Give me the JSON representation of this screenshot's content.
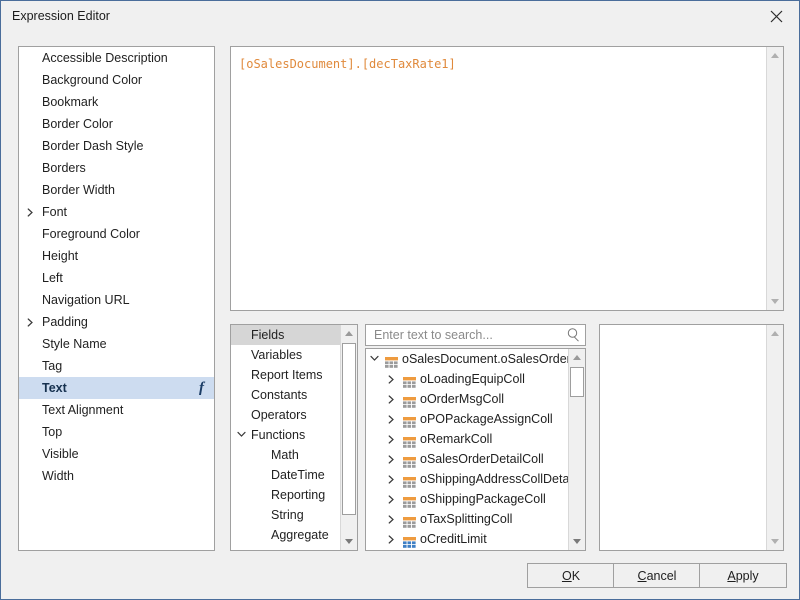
{
  "window": {
    "title": "Expression Editor",
    "close_icon": "close-icon",
    "border_color": "#4a6d9b",
    "background": "#f0f0f0"
  },
  "expression": {
    "value": "[oSalesDocument].[decTaxRate1]",
    "color": "#e08a3c"
  },
  "properties": {
    "selected": "Text",
    "selected_highlight": "#cddcf0",
    "items": [
      {
        "label": "Accessible Description",
        "expandable": false,
        "fx": false
      },
      {
        "label": "Background Color",
        "expandable": false,
        "fx": false
      },
      {
        "label": "Bookmark",
        "expandable": false,
        "fx": false
      },
      {
        "label": "Border Color",
        "expandable": false,
        "fx": false
      },
      {
        "label": "Border Dash Style",
        "expandable": false,
        "fx": false
      },
      {
        "label": "Borders",
        "expandable": false,
        "fx": false
      },
      {
        "label": "Border Width",
        "expandable": false,
        "fx": false
      },
      {
        "label": "Font",
        "expandable": true,
        "fx": false
      },
      {
        "label": "Foreground Color",
        "expandable": false,
        "fx": false
      },
      {
        "label": "Height",
        "expandable": false,
        "fx": false
      },
      {
        "label": "Left",
        "expandable": false,
        "fx": false
      },
      {
        "label": "Navigation URL",
        "expandable": false,
        "fx": false
      },
      {
        "label": "Padding",
        "expandable": true,
        "fx": false
      },
      {
        "label": "Style Name",
        "expandable": false,
        "fx": false
      },
      {
        "label": "Tag",
        "expandable": false,
        "fx": false
      },
      {
        "label": "Text",
        "expandable": false,
        "fx": true,
        "fx_glyph": "f"
      },
      {
        "label": "Text Alignment",
        "expandable": false,
        "fx": false
      },
      {
        "label": "Top",
        "expandable": false,
        "fx": false
      },
      {
        "label": "Visible",
        "expandable": false,
        "fx": false
      },
      {
        "label": "Width",
        "expandable": false,
        "fx": false
      }
    ]
  },
  "categories": {
    "selected": "Fields",
    "selected_highlight": "#d6d6d6",
    "items": [
      {
        "label": "Fields",
        "level": 0,
        "expandable": false
      },
      {
        "label": "Variables",
        "level": 0,
        "expandable": false
      },
      {
        "label": "Report Items",
        "level": 0,
        "expandable": false
      },
      {
        "label": "Constants",
        "level": 0,
        "expandable": false
      },
      {
        "label": "Operators",
        "level": 0,
        "expandable": false
      },
      {
        "label": "Functions",
        "level": 0,
        "expandable": true,
        "expanded": true
      },
      {
        "label": "Math",
        "level": 1,
        "expandable": false
      },
      {
        "label": "DateTime",
        "level": 1,
        "expandable": false
      },
      {
        "label": "Reporting",
        "level": 1,
        "expandable": false
      },
      {
        "label": "String",
        "level": 1,
        "expandable": false
      },
      {
        "label": "Aggregate",
        "level": 1,
        "expandable": false
      }
    ]
  },
  "search": {
    "placeholder": "Enter text to search...",
    "value": "",
    "icon": "search-icon"
  },
  "tree": {
    "nodes": [
      {
        "label": "oSalesDocument.oSalesOrder...",
        "level": 0,
        "expanded": true,
        "icon": "table-icon-orange"
      },
      {
        "label": "oLoadingEquipColl",
        "level": 1,
        "expanded": false,
        "icon": "table-icon-orange"
      },
      {
        "label": "oOrderMsgColl",
        "level": 1,
        "expanded": false,
        "icon": "table-icon-orange"
      },
      {
        "label": "oPOPackageAssignColl",
        "level": 1,
        "expanded": false,
        "icon": "table-icon-orange"
      },
      {
        "label": "oRemarkColl",
        "level": 1,
        "expanded": false,
        "icon": "table-icon-orange"
      },
      {
        "label": "oSalesOrderDetailColl",
        "level": 1,
        "expanded": false,
        "icon": "table-icon-orange"
      },
      {
        "label": "oShippingAddressCollDetail",
        "level": 1,
        "expanded": false,
        "icon": "table-icon-orange"
      },
      {
        "label": "oShippingPackageColl",
        "level": 1,
        "expanded": false,
        "icon": "table-icon-orange"
      },
      {
        "label": "oTaxSplittingColl",
        "level": 1,
        "expanded": false,
        "icon": "table-icon-orange"
      },
      {
        "label": "oCreditLimit",
        "level": 1,
        "expanded": false,
        "icon": "table-icon-blue"
      }
    ]
  },
  "preview": {
    "content": ""
  },
  "buttons": {
    "ok": {
      "label": "OK",
      "mnemonic": "O"
    },
    "cancel": {
      "label": "Cancel",
      "mnemonic": "C"
    },
    "apply": {
      "label": "Apply",
      "mnemonic": "A"
    }
  }
}
